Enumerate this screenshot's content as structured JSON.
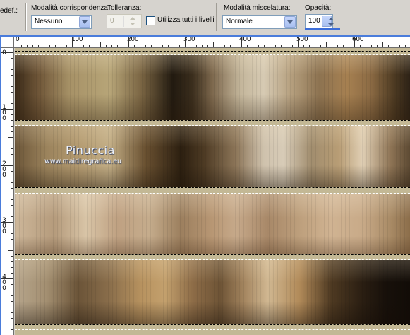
{
  "toolbar": {
    "preset_label": "edef.:",
    "match_mode": {
      "label": "Modalità corrispondenza:",
      "value": "Nessuno"
    },
    "tolerance": {
      "label": "Tolleranza:",
      "value": "0"
    },
    "all_layers": {
      "label": "Utilizza tutti i livelli",
      "checked": false
    },
    "blend_mode": {
      "label": "Modalità miscelatura:",
      "value": "Normale"
    },
    "opacity": {
      "label": "Opacità:",
      "value": "100",
      "level_percent": 100
    }
  },
  "ruler": {
    "horizontal": [
      "0",
      "100",
      "200",
      "300",
      "400",
      "500",
      "600"
    ],
    "vertical": [
      "0",
      "100",
      "200",
      "300",
      "400"
    ]
  },
  "watermark": {
    "name": "Pinuccia",
    "url": "www.maidiregrafica.eu"
  },
  "colors": {
    "toolbar_bg": "#d6d3ce",
    "combo_border": "#7f9db9",
    "guide_blue": "#4a7cdb",
    "canvas_strip": "#c3b895"
  }
}
